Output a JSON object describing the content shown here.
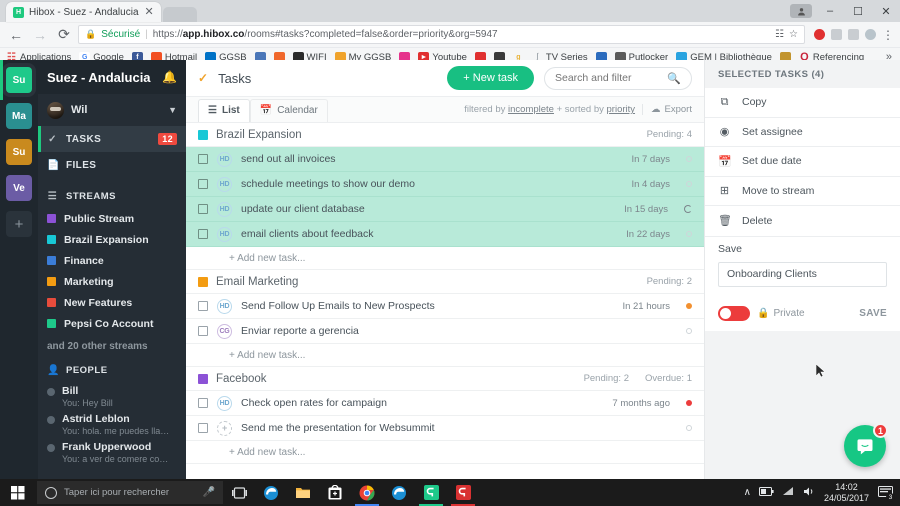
{
  "browser": {
    "tab": {
      "title": "Hibox - Suez - Andalucia",
      "favicon_letter": "H",
      "close_icon": "close-icon"
    },
    "window": {
      "minimize": "–",
      "maximize": "❐",
      "close": "✕"
    },
    "nav": {
      "back": "←",
      "forward": "→",
      "reload": "⟳"
    },
    "omnibox": {
      "security_label": "Sécurisé",
      "url_prefix": "https://",
      "url_bold": "app.hibox.co",
      "url_rest": "/rooms#tasks?completed=false&order=priority&org=5947"
    },
    "bookmarks": [
      {
        "label": "Applications",
        "icon": "apps-grid-icon",
        "color": "#e05252"
      },
      {
        "label": "Google",
        "icon": "google-icon",
        "color": "#ffffff"
      },
      {
        "label": "",
        "icon": "facebook-icon",
        "color": "#3b5998"
      },
      {
        "label": "Hotmail",
        "icon": "microsoft-icon",
        "color": "#f25022"
      },
      {
        "label": "GGSB",
        "icon": "outlook-icon",
        "color": "#0072c6"
      },
      {
        "label": "",
        "icon": "blue-page-icon",
        "color": "#4a76b8"
      },
      {
        "label": "",
        "icon": "orange-circle-icon",
        "color": "#f0672b"
      },
      {
        "label": "WIFI",
        "icon": "wifi-icon",
        "color": "#2b2b2b"
      },
      {
        "label": "My GGSB",
        "icon": "orange-box-icon",
        "color": "#f0a32b"
      },
      {
        "label": "",
        "icon": "pink-c-icon",
        "color": "#e6338c"
      },
      {
        "label": "Youtube",
        "icon": "youtube-icon",
        "color": "#e02f2f"
      },
      {
        "label": "",
        "icon": "red-circle-icon",
        "color": "#e03030"
      },
      {
        "label": "",
        "icon": "dark-square-icon",
        "color": "#3a3a3a"
      },
      {
        "label": "",
        "icon": "g-letter-icon",
        "color": "#e8b33a"
      },
      {
        "label": "TV Series",
        "icon": "tv-icon",
        "color": "#8d969d"
      },
      {
        "label": "",
        "icon": "blue-tool-icon",
        "color": "#2b6bbd"
      },
      {
        "label": "Putlocker",
        "icon": "film-icon",
        "color": "#5a5a5a"
      },
      {
        "label": "GEM | Bibliothèque",
        "icon": "gem-icon",
        "color": "#29a3e0"
      },
      {
        "label": "",
        "icon": "book-icon",
        "color": "#c2942e"
      },
      {
        "label": "Referencing",
        "icon": "quora-q-icon",
        "color": "#c8253c"
      }
    ],
    "bookmarks_overflow": "»"
  },
  "workspaces": [
    {
      "label": "Su",
      "color": "#1ec98a",
      "active": true
    },
    {
      "label": "Ma",
      "color": "#2a8f90",
      "active": false
    },
    {
      "label": "Su",
      "color": "#c98a1e",
      "active": false
    },
    {
      "label": "Ve",
      "color": "#6b5ca5",
      "active": false
    }
  ],
  "workspace_add": "+",
  "sidebar": {
    "workspace_title": "Suez - Andalucia",
    "bell_icon": "bell-icon",
    "user": {
      "name": "Wil",
      "avatar": "user-avatar",
      "chevron": "chevron-down-icon"
    },
    "nav": [
      {
        "label": "TASKS",
        "icon": "check-icon",
        "badge": "12",
        "active": true
      },
      {
        "label": "FILES",
        "icon": "file-icon",
        "badge": "",
        "active": false
      }
    ],
    "streams_header": {
      "label": "STREAMS",
      "icon": "streams-icon"
    },
    "streams": [
      {
        "label": "Public Stream",
        "color": "#8c52d6"
      },
      {
        "label": "Brazil Expansion",
        "color": "#18c8d6"
      },
      {
        "label": "Finance",
        "color": "#3b7dd8"
      },
      {
        "label": "Marketing",
        "color": "#f39c12"
      },
      {
        "label": "New Features",
        "color": "#e74c3c"
      },
      {
        "label": "Pepsi Co Account",
        "color": "#1ec98a"
      }
    ],
    "more_streams": "and 20 other streams",
    "people_header": {
      "label": "PEOPLE",
      "icon": "person-icon"
    },
    "people": [
      {
        "name": "Bill",
        "preview": "You: Hey Bill"
      },
      {
        "name": "Astrid Leblon",
        "preview": "You: hola. me puedes llamar..."
      },
      {
        "name": "Frank Upperwood",
        "preview": "You: a ver de comere comen"
      }
    ]
  },
  "main": {
    "title": "Tasks",
    "title_icon": "check-icon",
    "new_task_label": "+ New task",
    "search": {
      "placeholder": "Search and filter",
      "value": "",
      "icon": "search-icon"
    },
    "views": [
      {
        "label": "List",
        "icon": "list-icon",
        "active": true
      },
      {
        "label": "Calendar",
        "icon": "calendar-icon",
        "active": false
      }
    ],
    "filter_text_prefix": "filtered by ",
    "filter_incomplete": "incomplete",
    "filter_text_mid": " + sorted by ",
    "filter_priority": "priority",
    "export_label": "Export",
    "export_icon": "cloud-download-icon",
    "add_new_task_label": "+ Add new task...",
    "groups": [
      {
        "name": "Brazil Expansion",
        "color": "#18c8d6",
        "pending_label": "Pending: 4",
        "overdue_label": "",
        "tasks": [
          {
            "title": "send out all invoices",
            "assignee": "HD",
            "assignee_type": "hd",
            "due": "In 7 days",
            "status": "none",
            "selected": true
          },
          {
            "title": "schedule meetings to show our demo",
            "assignee": "HD",
            "assignee_type": "hd",
            "due": "In 4 days",
            "status": "none",
            "selected": true
          },
          {
            "title": "update our client database",
            "assignee": "HD",
            "assignee_type": "hd",
            "due": "In 15 days",
            "status": "refresh",
            "selected": true
          },
          {
            "title": "email clients about feedback",
            "assignee": "HD",
            "assignee_type": "hd",
            "due": "In 22 days",
            "status": "none",
            "selected": true
          }
        ]
      },
      {
        "name": "Email Marketing",
        "color": "#f39c12",
        "pending_label": "Pending: 2",
        "overdue_label": "",
        "tasks": [
          {
            "title": "Send Follow Up Emails to New Prospects",
            "assignee": "HD",
            "assignee_type": "hd",
            "due": "In 21 hours",
            "status": "orange",
            "selected": false
          },
          {
            "title": "Enviar reporte a gerencia",
            "assignee": "CG",
            "assignee_type": "cg",
            "due": "",
            "status": "none",
            "selected": false
          }
        ]
      },
      {
        "name": "Facebook",
        "color": "#8c52d6",
        "pending_label": "Pending: 2",
        "overdue_label": "Overdue: 1",
        "tasks": [
          {
            "title": "Check open rates for campaign",
            "assignee": "HD",
            "assignee_type": "hd",
            "due": "7 months ago",
            "status": "red",
            "selected": false
          },
          {
            "title": "Send me the presentation for Websummit",
            "assignee": "+",
            "assignee_type": "plus",
            "due": "",
            "status": "none",
            "selected": false
          }
        ]
      }
    ]
  },
  "right_panel": {
    "title": "SELECTED TASKS (4)",
    "actions": [
      {
        "label": "Copy",
        "icon": "copy-icon"
      },
      {
        "label": "Set assignee",
        "icon": "assignee-icon"
      },
      {
        "label": "Set due date",
        "icon": "calendar-icon"
      },
      {
        "label": "Move to stream",
        "icon": "move-icon"
      },
      {
        "label": "Delete",
        "icon": "trash-icon"
      }
    ],
    "save_label": "Save",
    "save_input_value": "Onboarding Clients",
    "private_label": "Private",
    "private_icon": "lock-icon",
    "private_enabled": false,
    "save_button": "SAVE",
    "toggle_color": "#ec3c3c"
  },
  "chat": {
    "badge": "1",
    "icon": "chat-bubble-icon",
    "color": "#16c784"
  },
  "taskbar": {
    "start_icon": "windows-icon",
    "search_placeholder": "Taper ici pour rechercher",
    "search_icon": "cortana-circle-icon",
    "mic_icon": "microphone-icon",
    "apps": [
      {
        "name": "task-view-icon",
        "color": "#d9dbdd"
      },
      {
        "name": "edge-icon",
        "color": "#1b8fd4"
      },
      {
        "name": "file-explorer-icon",
        "color": "#f2b33d"
      },
      {
        "name": "store-icon",
        "color": "#ffffff"
      },
      {
        "name": "chrome-icon",
        "color": "#4285f4"
      },
      {
        "name": "edge-icon-2",
        "color": "#1b8fd4"
      },
      {
        "name": "hibox-icon",
        "color": "#1ec98a"
      },
      {
        "name": "camtasia-icon",
        "color": "#d93232"
      }
    ],
    "tray": {
      "chevron": "∧",
      "battery": "battery-icon",
      "network": "wifi-icon",
      "volume": "volume-icon"
    },
    "clock_time": "14:02",
    "clock_date": "24/05/2017",
    "notification_count": "3"
  }
}
